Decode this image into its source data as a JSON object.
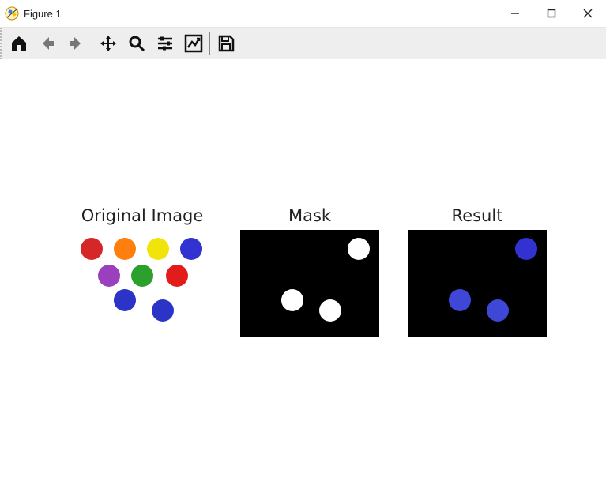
{
  "window": {
    "title": "Figure 1"
  },
  "toolbar": {
    "home": "Home",
    "back": "Back",
    "forward": "Forward",
    "pan": "Pan",
    "zoom": "Zoom",
    "subplots": "Configure subplots",
    "axes": "Edit axis",
    "save": "Save"
  },
  "panels": {
    "original": {
      "title": "Original Image"
    },
    "mask": {
      "title": "Mask"
    },
    "result": {
      "title": "Result"
    }
  },
  "chart_data": [
    {
      "type": "scatter",
      "title": "Original Image",
      "background": "#ffffff",
      "xlim": [
        0,
        176
      ],
      "ylim": [
        0,
        136
      ],
      "radius": 14,
      "points": [
        {
          "x": 24,
          "y": 24,
          "color": "#d62728"
        },
        {
          "x": 66,
          "y": 24,
          "color": "#ff7f0e"
        },
        {
          "x": 108,
          "y": 24,
          "color": "#f1e40a"
        },
        {
          "x": 150,
          "y": 24,
          "color": "#3232d0"
        },
        {
          "x": 46,
          "y": 58,
          "color": "#9a3fbd"
        },
        {
          "x": 88,
          "y": 58,
          "color": "#2ca02c"
        },
        {
          "x": 132,
          "y": 58,
          "color": "#e21b1b"
        },
        {
          "x": 66,
          "y": 89,
          "color": "#2b34c7"
        },
        {
          "x": 114,
          "y": 102,
          "color": "#2b34c7"
        }
      ]
    },
    {
      "type": "scatter",
      "title": "Mask",
      "background": "#000000",
      "xlim": [
        0,
        176
      ],
      "ylim": [
        0,
        136
      ],
      "radius": 14,
      "points": [
        {
          "x": 150,
          "y": 24,
          "color": "#ffffff"
        },
        {
          "x": 66,
          "y": 89,
          "color": "#ffffff"
        },
        {
          "x": 114,
          "y": 102,
          "color": "#ffffff"
        }
      ]
    },
    {
      "type": "scatter",
      "title": "Result",
      "background": "#000000",
      "xlim": [
        0,
        176
      ],
      "ylim": [
        0,
        136
      ],
      "radius": 14,
      "points": [
        {
          "x": 150,
          "y": 24,
          "color": "#3232d0"
        },
        {
          "x": 66,
          "y": 89,
          "color": "#3e47d6"
        },
        {
          "x": 114,
          "y": 102,
          "color": "#3e47d6"
        }
      ]
    }
  ]
}
